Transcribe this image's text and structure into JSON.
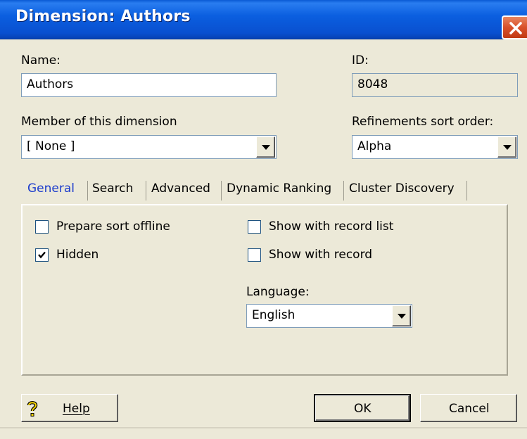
{
  "window": {
    "title": "Dimension:  Authors"
  },
  "fields": {
    "name_label": "Name:",
    "name_value": "Authors",
    "id_label": "ID:",
    "id_value": "8048",
    "member_label": "Member of this dimension",
    "member_value": "[ None ]",
    "sort_label": "Refinements sort order:",
    "sort_value": "Alpha"
  },
  "tabs": [
    {
      "label": "General",
      "active": true
    },
    {
      "label": "Search",
      "active": false
    },
    {
      "label": "Advanced",
      "active": false
    },
    {
      "label": "Dynamic Ranking",
      "active": false
    },
    {
      "label": "Cluster Discovery",
      "active": false
    }
  ],
  "general": {
    "prepare_sort_offline": {
      "label": "Prepare sort offline",
      "checked": false
    },
    "hidden": {
      "label": "Hidden",
      "checked": true
    },
    "show_with_record_list": {
      "label": "Show with record list",
      "checked": false
    },
    "show_with_record": {
      "label": "Show with record",
      "checked": false
    },
    "language_label": "Language:",
    "language_value": "English"
  },
  "buttons": {
    "help": "Help",
    "ok": "OK",
    "cancel": "Cancel"
  },
  "colors": {
    "titlebar": "#0b5fe0",
    "close": "#d9502a",
    "dialog_bg": "#ece9d8",
    "active_tab": "#1c3ccc"
  },
  "icons": {
    "close": "close-icon",
    "help": "help-question-icon",
    "dropdown": "chevron-down-icon",
    "check": "checkmark-icon"
  }
}
